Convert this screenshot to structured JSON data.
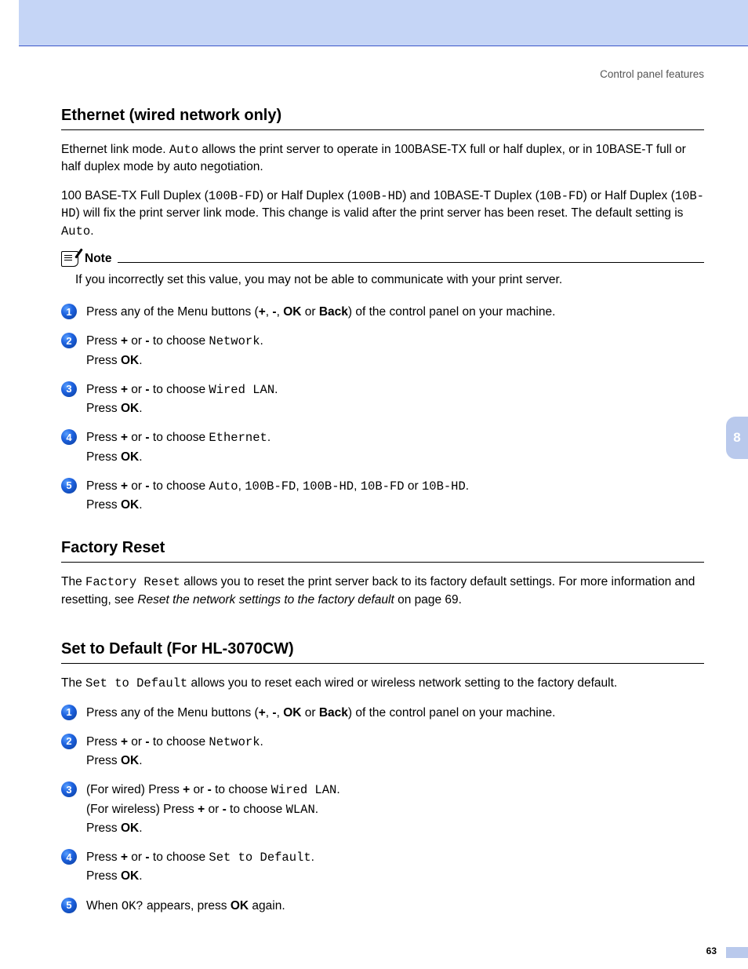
{
  "header": {
    "breadcrumb": "Control panel features"
  },
  "tab": {
    "chapter": "8"
  },
  "footer": {
    "page": "63"
  },
  "ethernet": {
    "heading": "Ethernet (wired network only)",
    "p1_a": "Ethernet link mode. ",
    "p1_code": "Auto",
    "p1_b": " allows the print server to operate in 100BASE-TX full or half duplex, or in 10BASE-T full or half duplex mode by auto negotiation.",
    "p2_a": "100 BASE-TX Full Duplex (",
    "p2_c1": "100B-FD",
    "p2_b": ") or Half Duplex (",
    "p2_c2": "100B-HD",
    "p2_c": ") and 10BASE-T Duplex (",
    "p2_c3": "10B-FD",
    "p2_d": ") or Half Duplex (",
    "p2_c4": "10B-HD",
    "p2_e": ") will fix the print server link mode. This change is valid after the print server has been reset. The default setting is ",
    "p2_c5": "Auto",
    "p2_f": ".",
    "note_label": "Note",
    "note_text": "If you incorrectly set this value, you may not be able to communicate with your print server.",
    "s1_a": "Press any of the Menu buttons (",
    "s1_plus": "+",
    "s1_comma1": ", ",
    "s1_minus": "-",
    "s1_comma2": ", ",
    "s1_ok": "OK",
    "s1_or": " or ",
    "s1_back": "Back",
    "s1_b": ") of the control panel on your machine.",
    "s2_a": "Press ",
    "s2_plus": "+",
    "s2_or": " or ",
    "s2_minus": "-",
    "s2_b": " to choose ",
    "s2_code": "Network",
    "s2_c": ".",
    "s2_press": "Press ",
    "s2_ok": "OK",
    "s2_d": ".",
    "s3_a": "Press ",
    "s3_plus": "+",
    "s3_or": " or ",
    "s3_minus": "-",
    "s3_b": " to choose ",
    "s3_code": "Wired LAN",
    "s3_c": ".",
    "s3_press": "Press ",
    "s3_ok": "OK",
    "s3_d": ".",
    "s4_a": "Press ",
    "s4_plus": "+",
    "s4_or": " or ",
    "s4_minus": "-",
    "s4_b": " to choose ",
    "s4_code": "Ethernet",
    "s4_c": ".",
    "s4_press": "Press ",
    "s4_ok": "OK",
    "s4_d": ".",
    "s5_a": "Press ",
    "s5_plus": "+",
    "s5_or": " or ",
    "s5_minus": "-",
    "s5_b": " to choose ",
    "s5_c1": "Auto",
    "s5_s1": ", ",
    "s5_c2": "100B-FD",
    "s5_s2": ", ",
    "s5_c3": "100B-HD",
    "s5_s3": ", ",
    "s5_c4": "10B-FD",
    "s5_s4": " or ",
    "s5_c5": "10B-HD",
    "s5_c": ".",
    "s5_press": "Press ",
    "s5_ok": "OK",
    "s5_d": "."
  },
  "factory": {
    "heading": "Factory Reset",
    "p_a": "The ",
    "p_code": "Factory Reset",
    "p_b": " allows you to reset the print server back to its factory default settings. For more information and resetting, see ",
    "p_italic": "Reset the network settings to the factory default",
    "p_c": " on page 69."
  },
  "setdefault": {
    "heading": "Set to Default (For HL-3070CW)",
    "p_a": "The ",
    "p_code": "Set to Default",
    "p_b": " allows you to reset each wired or wireless network setting to the factory default.",
    "s1_a": "Press any of the Menu buttons (",
    "s1_plus": "+",
    "s1_comma1": ", ",
    "s1_minus": "-",
    "s1_comma2": ", ",
    "s1_ok": "OK",
    "s1_or": " or ",
    "s1_back": "Back",
    "s1_b": ") of the control panel on your machine.",
    "s2_a": "Press ",
    "s2_plus": "+",
    "s2_or": " or ",
    "s2_minus": "-",
    "s2_b": " to choose ",
    "s2_code": "Network",
    "s2_c": ".",
    "s2_press": "Press ",
    "s2_ok": "OK",
    "s2_d": ".",
    "s3_w_a": "(For wired) Press ",
    "s3_plus": "+",
    "s3_or": " or ",
    "s3_minus": "-",
    "s3_w_b": " to choose ",
    "s3_code1": "Wired LAN",
    "s3_w_c": ".",
    "s3_wl_a": "(For wireless) Press ",
    "s3_plus2": "+",
    "s3_or2": " or ",
    "s3_minus2": "-",
    "s3_wl_b": " to choose ",
    "s3_code2": "WLAN",
    "s3_wl_c": ".",
    "s3_press": "Press ",
    "s3_ok": "OK",
    "s3_d": ".",
    "s4_a": "Press ",
    "s4_plus": "+",
    "s4_or": " or ",
    "s4_minus": "-",
    "s4_b": " to choose ",
    "s4_code": "Set to Default",
    "s4_c": ".",
    "s4_press": "Press ",
    "s4_ok": "OK",
    "s4_d": ".",
    "s5_a": "When ",
    "s5_code": "OK?",
    "s5_b": " appears, press ",
    "s5_ok": "OK",
    "s5_c": " again."
  },
  "nums": {
    "n1": "1",
    "n2": "2",
    "n3": "3",
    "n4": "4",
    "n5": "5"
  }
}
